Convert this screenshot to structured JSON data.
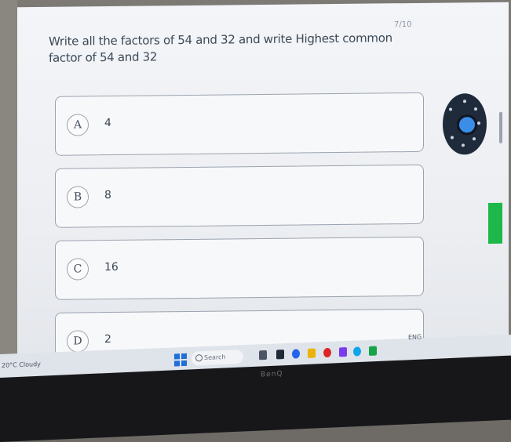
{
  "quiz": {
    "question": "Write all the factors of 54 and 32 and write Highest common factor of 54 and 32",
    "counter": "7/10",
    "options": [
      {
        "letter": "A",
        "text": "4"
      },
      {
        "letter": "B",
        "text": "8"
      },
      {
        "letter": "C",
        "text": "16"
      },
      {
        "letter": "D",
        "text": "2"
      }
    ]
  },
  "taskbar": {
    "weather": "20°C Cloudy",
    "search_placeholder": "Search",
    "tray_time": "ENG"
  },
  "monitor": {
    "brand": "BenQ"
  },
  "colors": {
    "accent_green": "#1eb84a",
    "dial_blue": "#3b8ee8"
  }
}
